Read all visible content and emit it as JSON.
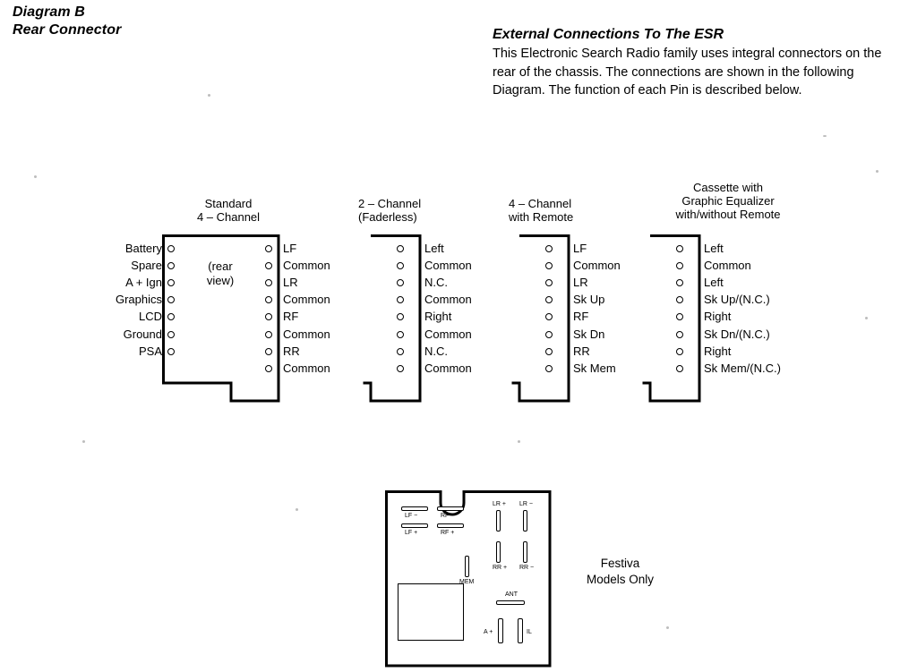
{
  "page": {
    "diagram_label": "Diagram B",
    "diagram_subtitle": "Rear Connector",
    "esr_heading": "External Connections To The ESR",
    "esr_paragraph": "This Electronic Search Radio family uses integral connectors on the rear of the chassis. The connections are shown in the following Diagram. The function of each Pin is described below."
  },
  "connectors": [
    {
      "id": "standard-4-channel",
      "heading_line1": "Standard",
      "heading_line2": "4 – Channel",
      "inner_note": "(rear\nview)",
      "inner_note_line1": "(rear",
      "inner_note_line2": "view)",
      "left_pins": [
        "Battery",
        "Spare",
        "A +  Ign",
        "Graphics",
        "LCD",
        "Ground",
        "PSA"
      ],
      "right_pins": [
        "LF",
        "Common",
        "LR",
        "Common",
        "RF",
        "Common",
        "RR",
        "Common"
      ]
    },
    {
      "id": "two-channel-faderless",
      "heading_line1": "2 – Channel",
      "heading_line2": "(Faderless)",
      "right_pins": [
        "Left",
        "Common",
        "N.C.",
        "Common",
        "Right",
        "Common",
        "N.C.",
        "Common"
      ]
    },
    {
      "id": "four-channel-remote",
      "heading_line1": "4 – Channel",
      "heading_line2": "with Remote",
      "right_pins": [
        "LF",
        "Common",
        "LR",
        "Sk Up",
        "RF",
        "Sk Dn",
        "RR",
        "Sk Mem"
      ]
    },
    {
      "id": "cassette-graphic-equalizer",
      "heading_line1": "Cassette with",
      "heading_line2": "Graphic Equalizer",
      "heading_line3": "with/without Remote",
      "right_pins": [
        "Left",
        "Common",
        "Left",
        "Sk Up/(N.C.)",
        "Right",
        "Sk Dn/(N.C.)",
        "Right",
        "Sk Mem/(N.C.)"
      ]
    }
  ],
  "festiva": {
    "caption_line1": "Festiva",
    "caption_line2": "Models Only",
    "terminals": [
      {
        "name": "LF −",
        "label": "LF −"
      },
      {
        "name": "RF −",
        "label": "RF −"
      },
      {
        "name": "LF +",
        "label": "LF +"
      },
      {
        "name": "RF +",
        "label": "RF +"
      },
      {
        "name": "LR +",
        "label": "LR +"
      },
      {
        "name": "LR −",
        "label": "LR −"
      },
      {
        "name": "RR +",
        "label": "RR +"
      },
      {
        "name": "RR −",
        "label": "RR −"
      },
      {
        "name": "MEM",
        "label": "MEM"
      },
      {
        "name": "ANT",
        "label": "ANT"
      },
      {
        "name": "A +",
        "label": "A +"
      },
      {
        "name": "IL",
        "label": "IL"
      }
    ]
  },
  "colors": {
    "ink": "#000000",
    "paper": "#ffffff"
  }
}
